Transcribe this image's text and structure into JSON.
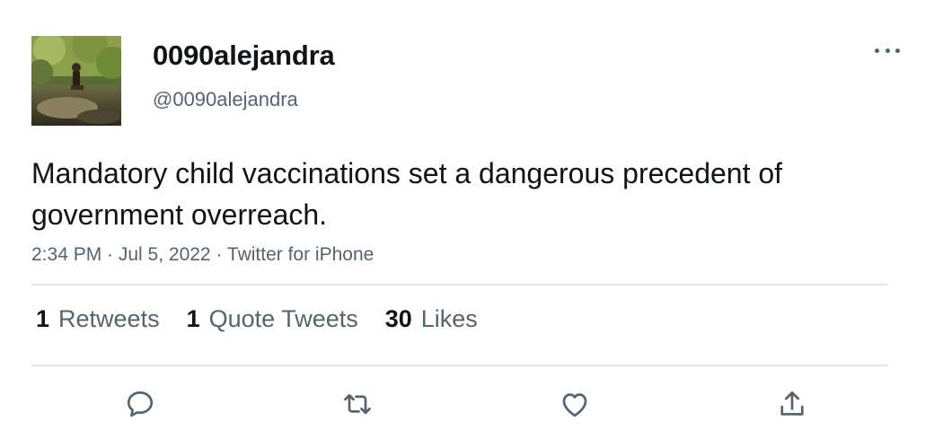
{
  "tweet": {
    "display_name": "0090alejandra",
    "handle": "@0090alejandra",
    "text": "Mandatory child vaccinations set a dangerous precedent of government overreach.",
    "meta": "2:34 PM · Jul 5, 2022 · Twitter for iPhone"
  },
  "stats": [
    {
      "count": "1",
      "label": "Retweets"
    },
    {
      "count": "1",
      "label": "Quote Tweets"
    },
    {
      "count": "30",
      "label": "Likes"
    }
  ],
  "actions": {
    "reply": "reply-icon",
    "retweet": "retweet-icon",
    "like": "heart-icon",
    "share": "share-icon"
  },
  "colors": {
    "text_primary": "#0f1419",
    "text_secondary": "#536471",
    "divider": "#e2e6e9"
  }
}
